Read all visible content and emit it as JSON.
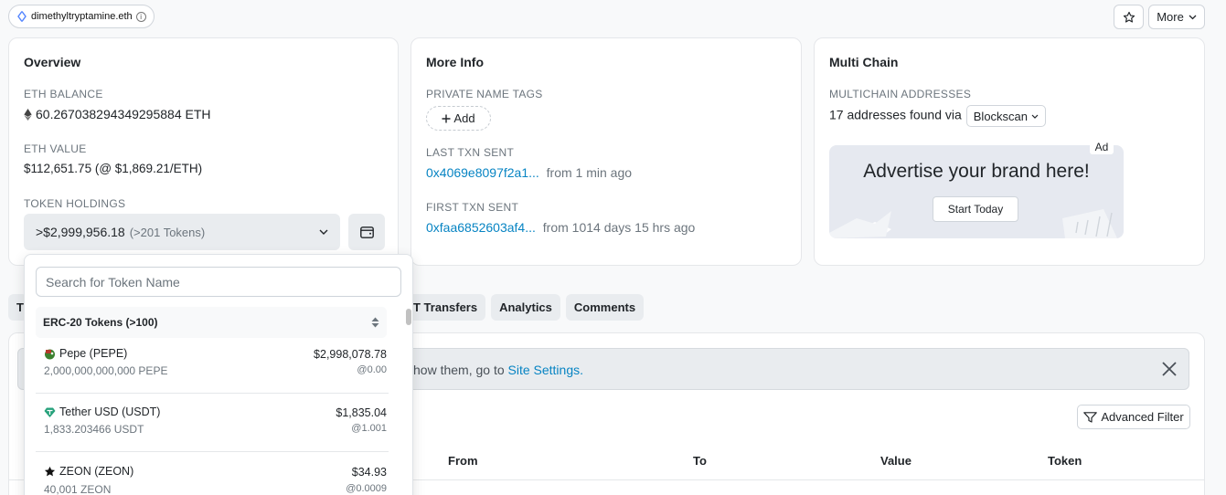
{
  "header": {
    "ens_name": "dimethyltryptamine.eth",
    "more_label": "More"
  },
  "overview": {
    "title": "Overview",
    "eth_balance_label": "ETH BALANCE",
    "eth_balance": "60.267038294349295884 ETH",
    "eth_value_label": "ETH VALUE",
    "eth_value": "$112,651.75 (@ $1,869.21/ETH)",
    "token_holdings_label": "TOKEN HOLDINGS",
    "token_total": ">$2,999,956.18",
    "token_count": "(>201 Tokens)"
  },
  "more_info": {
    "title": "More Info",
    "private_tags_label": "PRIVATE NAME TAGS",
    "add_label": "Add",
    "last_txn_label": "LAST TXN SENT",
    "last_txn_hash": "0x4069e8097f2a1...",
    "last_txn_time": "from 1 min ago",
    "first_txn_label": "FIRST TXN SENT",
    "first_txn_hash": "0xfaa6852603af4...",
    "first_txn_time": "from 1014 days 15 hrs ago"
  },
  "multi_chain": {
    "title": "Multi Chain",
    "addresses_label": "MULTICHAIN ADDRESSES",
    "found_text": "17 addresses found via",
    "blockscan_label": "Blockscan",
    "ad_text": "Advertise your brand here!",
    "ad_button": "Start Today",
    "ad_badge": "Ad"
  },
  "tabs": [
    {
      "label": "T"
    },
    {
      "label": "T Transfers"
    },
    {
      "label": "Analytics"
    },
    {
      "label": "Comments"
    }
  ],
  "content": {
    "notice_prefix": "how them, go to ",
    "notice_link": "Site Settings.",
    "advanced_filter": "Advanced Filter",
    "columns": [
      "From",
      "To",
      "Value",
      "Token"
    ]
  },
  "token_dropdown": {
    "search_placeholder": "Search for Token Name",
    "group_label": "ERC-20 Tokens (>100)",
    "tokens": [
      {
        "name": "Pepe (PEPE)",
        "amount": "2,000,000,000,000 PEPE",
        "usd": "$2,998,078.78",
        "price": "@0.00",
        "icon": "pepe-icon"
      },
      {
        "name": "Tether USD (USDT)",
        "amount": "1,833.203466 USDT",
        "usd": "$1,835.04",
        "price": "@1.001",
        "icon": "tether-icon"
      },
      {
        "name": "ZEON (ZEON)",
        "amount": "40,001 ZEON",
        "usd": "$34.93",
        "price": "@0.0009",
        "icon": "star-icon"
      }
    ]
  },
  "colors": {
    "link": "#0784c3",
    "muted": "#6c757d",
    "tether": "#26a17b",
    "pepe": "#3d8130"
  }
}
